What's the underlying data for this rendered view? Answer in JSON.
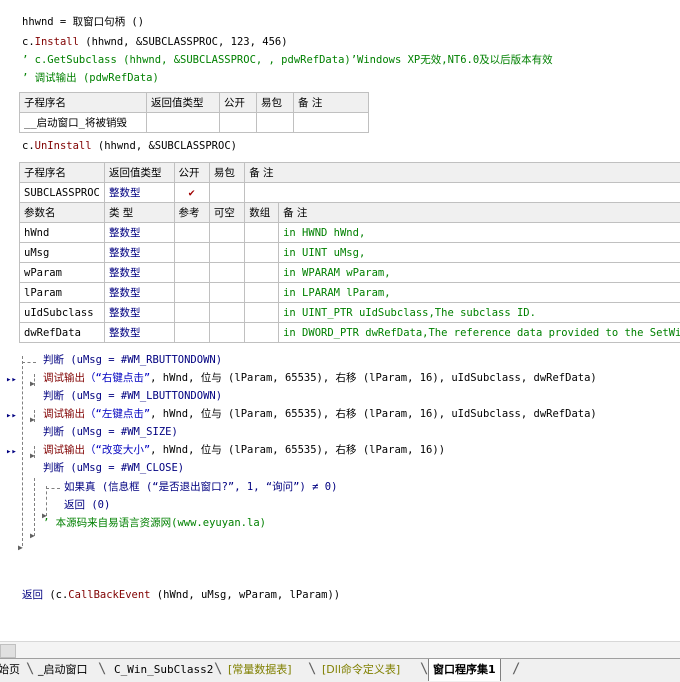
{
  "code": {
    "line1": "hhwnd = 取窗口句柄 ()",
    "line2_obj": "c.",
    "line2_fn": "Install",
    "line2_args": " (hhwnd, &SUBCLASSPROC, 123, 456)",
    "line3": "’ c.GetSubclass (hhwnd, &SUBCLASSPROC, , pdwRefData)’Windows XP无效,NT6.0及以后版本有效",
    "line4": "’ 调试输出 (pdwRefData)",
    "line5_obj": "c.",
    "line5_fn": "UnInstall",
    "line5_args": " (hhwnd, &SUBCLASSPROC)",
    "b1": "判断 (uMsg = #WM_RBUTTONDOWN)",
    "b1_call_fn": "调试输出",
    "b1_call_str": "（“右键点击”",
    "b1_call_rest": ", hWnd, 位与 (lParam, 65535), 右移 (lParam, 16), uIdSubclass, dwRefData)",
    "b2": "判断 (uMsg = #WM_LBUTTONDOWN)",
    "b2_call_fn": "调试输出",
    "b2_call_str": "（“左键点击”",
    "b2_call_rest": ", hWnd, 位与 (lParam, 65535), 右移 (lParam, 16), uIdSubclass, dwRefData)",
    "b3": "判断 (uMsg = #WM_SIZE)",
    "b3_call_fn": "调试输出",
    "b3_call_str": "（“改变大小”",
    "b3_call_rest": ", hWnd, 位与 (lParam, 65535), 右移 (lParam, 16))",
    "b4": "判断 (uMsg = #WM_CLOSE)",
    "b4_if": "如果真 (信息框 (“是否退出窗口?”, 1, “询问”) ≠ 0)",
    "b4_ret": "返回 (0)",
    "b5": "’ 本源码来自易语言资源网(www.eyuyan.la)",
    "final_kw": "返回",
    "final_obj": " (c.",
    "final_fn": "CallBackEvent",
    "final_args": " (hWnd, uMsg, wParam, lParam))"
  },
  "table1": {
    "headers": [
      "子程序名",
      "返回值类型",
      "公开",
      "易包",
      "备 注"
    ],
    "row": [
      "__启动窗口_将被销毁",
      "",
      "",
      "",
      ""
    ]
  },
  "table2": {
    "headers": [
      "子程序名",
      "返回值类型",
      "公开",
      "易包",
      "备 注"
    ],
    "row": [
      "SUBCLASSPROC",
      "整数型",
      "✔",
      "",
      ""
    ],
    "param_headers": [
      "参数名",
      "类 型",
      "参考",
      "可空",
      "数组",
      "备 注"
    ],
    "params": [
      [
        "hWnd",
        "整数型",
        "",
        "",
        "",
        "in HWND hWnd,"
      ],
      [
        "uMsg",
        "整数型",
        "",
        "",
        "",
        "in UINT uMsg,"
      ],
      [
        "wParam",
        "整数型",
        "",
        "",
        "",
        "in WPARAM wParam,"
      ],
      [
        "lParam",
        "整数型",
        "",
        "",
        "",
        "in LPARAM lParam,"
      ],
      [
        "uIdSubclass",
        "整数型",
        "",
        "",
        "",
        "in UINT_PTR uIdSubclass,The subclass ID."
      ],
      [
        "dwRefData",
        "整数型",
        "",
        "",
        "",
        "in DWORD_PTR dwRefData,The reference data provided to the SetWind"
      ]
    ]
  },
  "tabs": [
    {
      "label": "始页",
      "style": "normal"
    },
    {
      "label": "_启动窗口",
      "style": "normal"
    },
    {
      "label": "C_Win_SubClass2",
      "style": "normal"
    },
    {
      "label": "[常量数据表]",
      "style": "green"
    },
    {
      "label": "[Dll命令定义表]",
      "style": "green"
    },
    {
      "label": "窗口程序集1",
      "style": "active"
    }
  ],
  "colors": {
    "keyword": "#000080",
    "function": "#800000",
    "comment": "#008000",
    "string": "#0000c0"
  }
}
